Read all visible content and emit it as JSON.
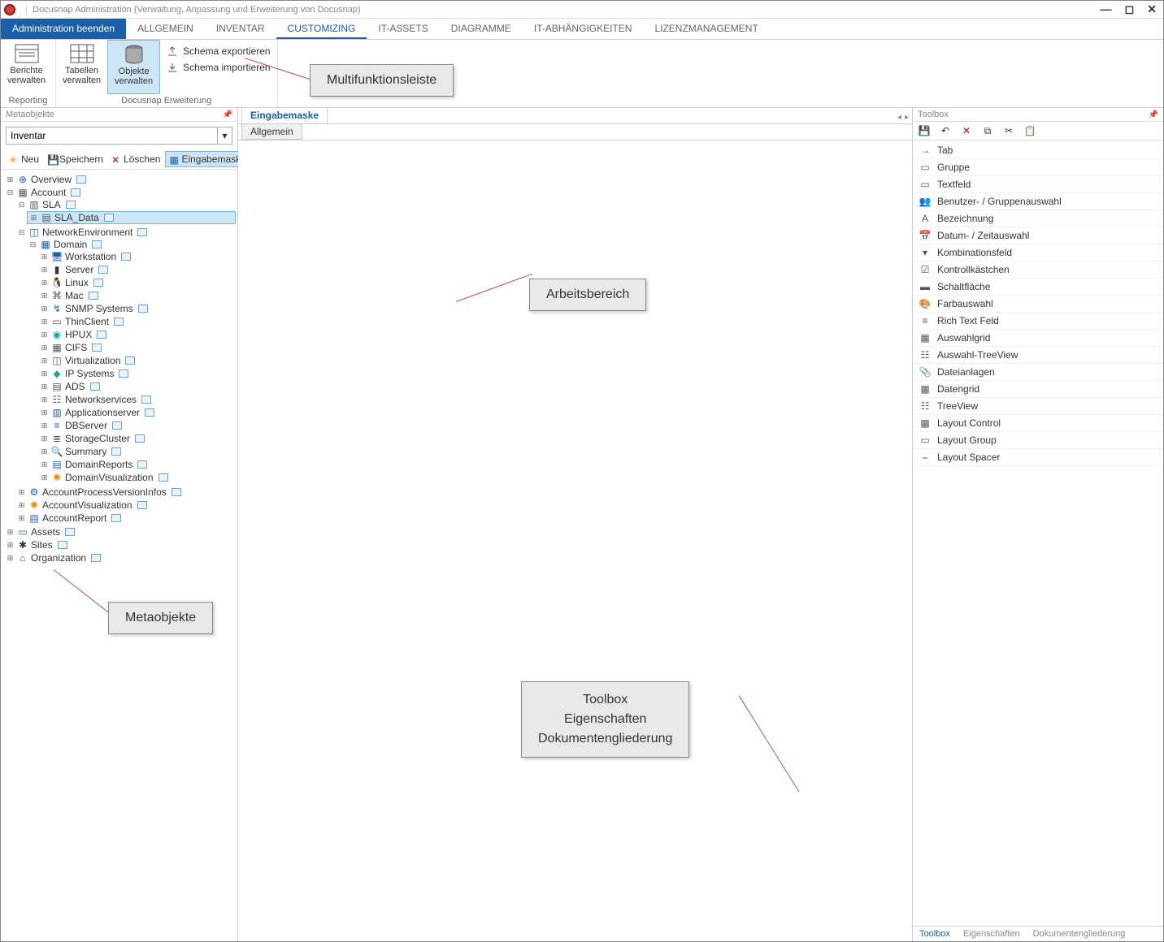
{
  "window": {
    "title": "Docusnap Administration (Verwaltung, Anpassung und Erweiterung von Docusnap)"
  },
  "menu": {
    "primary": "Administration beenden",
    "items": [
      "ALLGEMEIN",
      "INVENTAR",
      "CUSTOMIZING",
      "IT-ASSETS",
      "DIAGRAMME",
      "IT-ABHÄNGIGKEITEN",
      "LIZENZMANAGEMENT"
    ],
    "active_index": 2
  },
  "ribbon": {
    "group1": {
      "label": "Reporting",
      "btn1_l1": "Berichte",
      "btn1_l2": "verwalten"
    },
    "group2": {
      "label": "Docusnap Erweiterung",
      "btn1_l1": "Tabellen",
      "btn1_l2": "verwalten",
      "btn2_l1": "Objekte",
      "btn2_l2": "verwalten",
      "link1": "Schema exportieren",
      "link2": "Schema importieren"
    }
  },
  "metapanel": {
    "header": "Metaobjekte",
    "combo_value": "Inventar",
    "toolbar": {
      "neu": "Neu",
      "speichern": "Speichern",
      "loeschen": "Löschen",
      "eingabemaske": "Eingabemaske"
    },
    "tree": {
      "overview": "Overview",
      "account": "Account",
      "sla": "SLA",
      "sla_data": "SLA_Data",
      "netenv": "NetworkEnvironment",
      "domain": "Domain",
      "children": [
        "Workstation",
        "Server",
        "Linux",
        "Mac",
        "SNMP Systems",
        "ThinClient",
        "HPUX",
        "CIFS",
        "Virtualization",
        "IP Systems",
        "ADS",
        "Networkservices",
        "Applicationserver",
        "DBServer",
        "StorageCluster",
        "Summary",
        "DomainReports",
        "DomainVisualization"
      ],
      "account_extra": [
        "AccountProcessVersionInfos",
        "AccountVisualization",
        "AccountReport"
      ],
      "roots_extra": [
        "Assets",
        "Sites",
        "Organization"
      ]
    }
  },
  "center": {
    "tab": "Eingabemaske",
    "subtab": "Allgemein"
  },
  "toolbox": {
    "header": "Toolbox",
    "items": [
      "Tab",
      "Gruppe",
      "Textfeld",
      "Benutzer- / Gruppenauswahl",
      "Bezeichnung",
      "Datum- / Zeitauswahl",
      "Kombinationsfeld",
      "Kontrollkästchen",
      "Schaltfläche",
      "Farbauswahl",
      "Rich Text Feld",
      "Auswahlgrid",
      "Auswahl-TreeView",
      "Dateianlagen",
      "Datengrid",
      "TreeView",
      "Layout Control",
      "Layout Group",
      "Layout Spacer"
    ],
    "tabs": [
      "Toolbox",
      "Eigenschaften",
      "Dokumentengliederung"
    ]
  },
  "callouts": {
    "ribbon": "Multifunktionsleiste",
    "meta": "Metaobjekte",
    "work": "Arbeitsbereich",
    "right_l1": "Toolbox",
    "right_l2": "Eigenschaften",
    "right_l3": "Dokumentengliederung"
  }
}
